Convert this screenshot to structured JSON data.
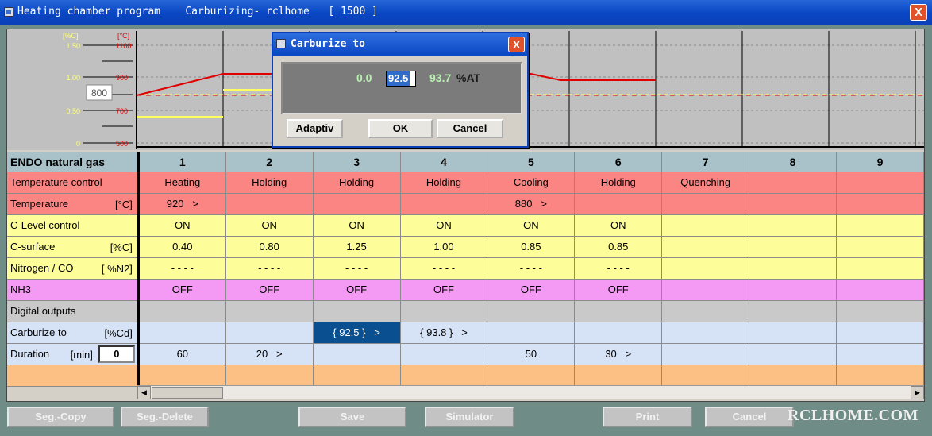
{
  "window": {
    "title": "Heating chamber program    Carburizing- rclhome   [ 1500 ]",
    "close": "X"
  },
  "chart": {
    "axis_percent_unit": "[%C]",
    "axis_temp_unit": "[°C]",
    "percent_ticks": [
      "1.50",
      "1.00",
      "0.50",
      "0"
    ],
    "temp_ticks": [
      "1100",
      "900",
      "700",
      "500"
    ],
    "current_temp": "800",
    "colors": {
      "setpoint": "#e00000",
      "carbon": "#ffff60",
      "ticks_percent": "#ffff80"
    }
  },
  "grid": {
    "header_label": "ENDO natural gas",
    "columns": [
      "1",
      "2",
      "3",
      "4",
      "5",
      "6",
      "7",
      "8",
      "9"
    ],
    "rows": [
      {
        "label": "Temperature control",
        "unit": "",
        "class": "r-temp",
        "cells": [
          "Heating",
          "Holding",
          "Holding",
          "Holding",
          "Cooling",
          "Holding",
          "Quenching",
          "",
          ""
        ]
      },
      {
        "label": "Temperature",
        "unit": "[°C]",
        "class": "r-temp",
        "cells": [
          "920   >",
          "",
          "",
          "",
          "880   >",
          "",
          "",
          "",
          ""
        ]
      },
      {
        "label": "C-Level control",
        "unit": "",
        "class": "r-yel",
        "cells": [
          "ON",
          "ON",
          "ON",
          "ON",
          "ON",
          "ON",
          "",
          "",
          ""
        ]
      },
      {
        "label": "C-surface",
        "unit": "[%C]",
        "class": "r-yel",
        "cells": [
          "0.40",
          "0.80",
          "1.25",
          "1.00",
          "0.85",
          "0.85",
          "",
          "",
          ""
        ]
      },
      {
        "label": "Nitrogen / CO",
        "unit": "[ %N2]",
        "class": "r-yel",
        "cells": [
          "- - - -",
          "- - - -",
          "- - - -",
          "- - - -",
          "- - - -",
          "- - - -",
          "",
          "",
          ""
        ]
      },
      {
        "label": "NH3",
        "unit": "",
        "class": "r-nh3",
        "cells": [
          "OFF",
          "OFF",
          "OFF",
          "OFF",
          "OFF",
          "OFF",
          "",
          "",
          ""
        ]
      },
      {
        "label": "Digital outputs",
        "unit": "",
        "class": "r-dig",
        "cells": [
          "",
          "",
          "",
          "",
          "",
          "",
          "",
          "",
          ""
        ]
      },
      {
        "label": "Carburize to",
        "unit": "[%Cd]",
        "class": "r-blue",
        "cells": [
          "",
          "",
          "{ 92.5 }   >",
          "{ 93.8 }   >",
          "",
          "",
          "",
          "",
          ""
        ]
      },
      {
        "label": "Duration",
        "unit": "[min]",
        "class": "r-blue",
        "cells": [
          "60",
          "20   >",
          "",
          "",
          "50",
          "30   >",
          "",
          "",
          ""
        ],
        "input": "0"
      },
      {
        "label": "",
        "unit": "",
        "class": "r-orange",
        "cells": [
          "",
          "",
          "",
          "",
          "",
          "",
          "",
          "",
          ""
        ]
      }
    ]
  },
  "buttons": {
    "seg_copy": "Seg.-Copy",
    "seg_delete": "Seg.-Delete",
    "save": "Save",
    "simulator": "Simulator",
    "print": "Print",
    "cancel": "Cancel"
  },
  "watermark": "RCLHOME.COM",
  "dialog": {
    "title": "Carburize to",
    "min": "0.0",
    "current": "92.5",
    "max": "93.7",
    "unit": "%AT",
    "adaptive": "Adaptiv",
    "ok": "OK",
    "cancel": "Cancel"
  }
}
